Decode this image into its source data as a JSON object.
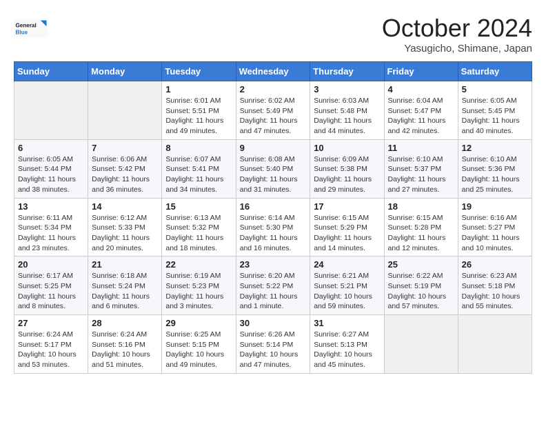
{
  "logo": {
    "line1": "General",
    "line2": "Blue"
  },
  "title": "October 2024",
  "location": "Yasugicho, Shimane, Japan",
  "days_of_week": [
    "Sunday",
    "Monday",
    "Tuesday",
    "Wednesday",
    "Thursday",
    "Friday",
    "Saturday"
  ],
  "weeks": [
    [
      {
        "day": "",
        "info": ""
      },
      {
        "day": "",
        "info": ""
      },
      {
        "day": "1",
        "info": "Sunrise: 6:01 AM\nSunset: 5:51 PM\nDaylight: 11 hours and 49 minutes."
      },
      {
        "day": "2",
        "info": "Sunrise: 6:02 AM\nSunset: 5:49 PM\nDaylight: 11 hours and 47 minutes."
      },
      {
        "day": "3",
        "info": "Sunrise: 6:03 AM\nSunset: 5:48 PM\nDaylight: 11 hours and 44 minutes."
      },
      {
        "day": "4",
        "info": "Sunrise: 6:04 AM\nSunset: 5:47 PM\nDaylight: 11 hours and 42 minutes."
      },
      {
        "day": "5",
        "info": "Sunrise: 6:05 AM\nSunset: 5:45 PM\nDaylight: 11 hours and 40 minutes."
      }
    ],
    [
      {
        "day": "6",
        "info": "Sunrise: 6:05 AM\nSunset: 5:44 PM\nDaylight: 11 hours and 38 minutes."
      },
      {
        "day": "7",
        "info": "Sunrise: 6:06 AM\nSunset: 5:42 PM\nDaylight: 11 hours and 36 minutes."
      },
      {
        "day": "8",
        "info": "Sunrise: 6:07 AM\nSunset: 5:41 PM\nDaylight: 11 hours and 34 minutes."
      },
      {
        "day": "9",
        "info": "Sunrise: 6:08 AM\nSunset: 5:40 PM\nDaylight: 11 hours and 31 minutes."
      },
      {
        "day": "10",
        "info": "Sunrise: 6:09 AM\nSunset: 5:38 PM\nDaylight: 11 hours and 29 minutes."
      },
      {
        "day": "11",
        "info": "Sunrise: 6:10 AM\nSunset: 5:37 PM\nDaylight: 11 hours and 27 minutes."
      },
      {
        "day": "12",
        "info": "Sunrise: 6:10 AM\nSunset: 5:36 PM\nDaylight: 11 hours and 25 minutes."
      }
    ],
    [
      {
        "day": "13",
        "info": "Sunrise: 6:11 AM\nSunset: 5:34 PM\nDaylight: 11 hours and 23 minutes."
      },
      {
        "day": "14",
        "info": "Sunrise: 6:12 AM\nSunset: 5:33 PM\nDaylight: 11 hours and 20 minutes."
      },
      {
        "day": "15",
        "info": "Sunrise: 6:13 AM\nSunset: 5:32 PM\nDaylight: 11 hours and 18 minutes."
      },
      {
        "day": "16",
        "info": "Sunrise: 6:14 AM\nSunset: 5:30 PM\nDaylight: 11 hours and 16 minutes."
      },
      {
        "day": "17",
        "info": "Sunrise: 6:15 AM\nSunset: 5:29 PM\nDaylight: 11 hours and 14 minutes."
      },
      {
        "day": "18",
        "info": "Sunrise: 6:15 AM\nSunset: 5:28 PM\nDaylight: 11 hours and 12 minutes."
      },
      {
        "day": "19",
        "info": "Sunrise: 6:16 AM\nSunset: 5:27 PM\nDaylight: 11 hours and 10 minutes."
      }
    ],
    [
      {
        "day": "20",
        "info": "Sunrise: 6:17 AM\nSunset: 5:25 PM\nDaylight: 11 hours and 8 minutes."
      },
      {
        "day": "21",
        "info": "Sunrise: 6:18 AM\nSunset: 5:24 PM\nDaylight: 11 hours and 6 minutes."
      },
      {
        "day": "22",
        "info": "Sunrise: 6:19 AM\nSunset: 5:23 PM\nDaylight: 11 hours and 3 minutes."
      },
      {
        "day": "23",
        "info": "Sunrise: 6:20 AM\nSunset: 5:22 PM\nDaylight: 11 hours and 1 minute."
      },
      {
        "day": "24",
        "info": "Sunrise: 6:21 AM\nSunset: 5:21 PM\nDaylight: 10 hours and 59 minutes."
      },
      {
        "day": "25",
        "info": "Sunrise: 6:22 AM\nSunset: 5:19 PM\nDaylight: 10 hours and 57 minutes."
      },
      {
        "day": "26",
        "info": "Sunrise: 6:23 AM\nSunset: 5:18 PM\nDaylight: 10 hours and 55 minutes."
      }
    ],
    [
      {
        "day": "27",
        "info": "Sunrise: 6:24 AM\nSunset: 5:17 PM\nDaylight: 10 hours and 53 minutes."
      },
      {
        "day": "28",
        "info": "Sunrise: 6:24 AM\nSunset: 5:16 PM\nDaylight: 10 hours and 51 minutes."
      },
      {
        "day": "29",
        "info": "Sunrise: 6:25 AM\nSunset: 5:15 PM\nDaylight: 10 hours and 49 minutes."
      },
      {
        "day": "30",
        "info": "Sunrise: 6:26 AM\nSunset: 5:14 PM\nDaylight: 10 hours and 47 minutes."
      },
      {
        "day": "31",
        "info": "Sunrise: 6:27 AM\nSunset: 5:13 PM\nDaylight: 10 hours and 45 minutes."
      },
      {
        "day": "",
        "info": ""
      },
      {
        "day": "",
        "info": ""
      }
    ]
  ]
}
